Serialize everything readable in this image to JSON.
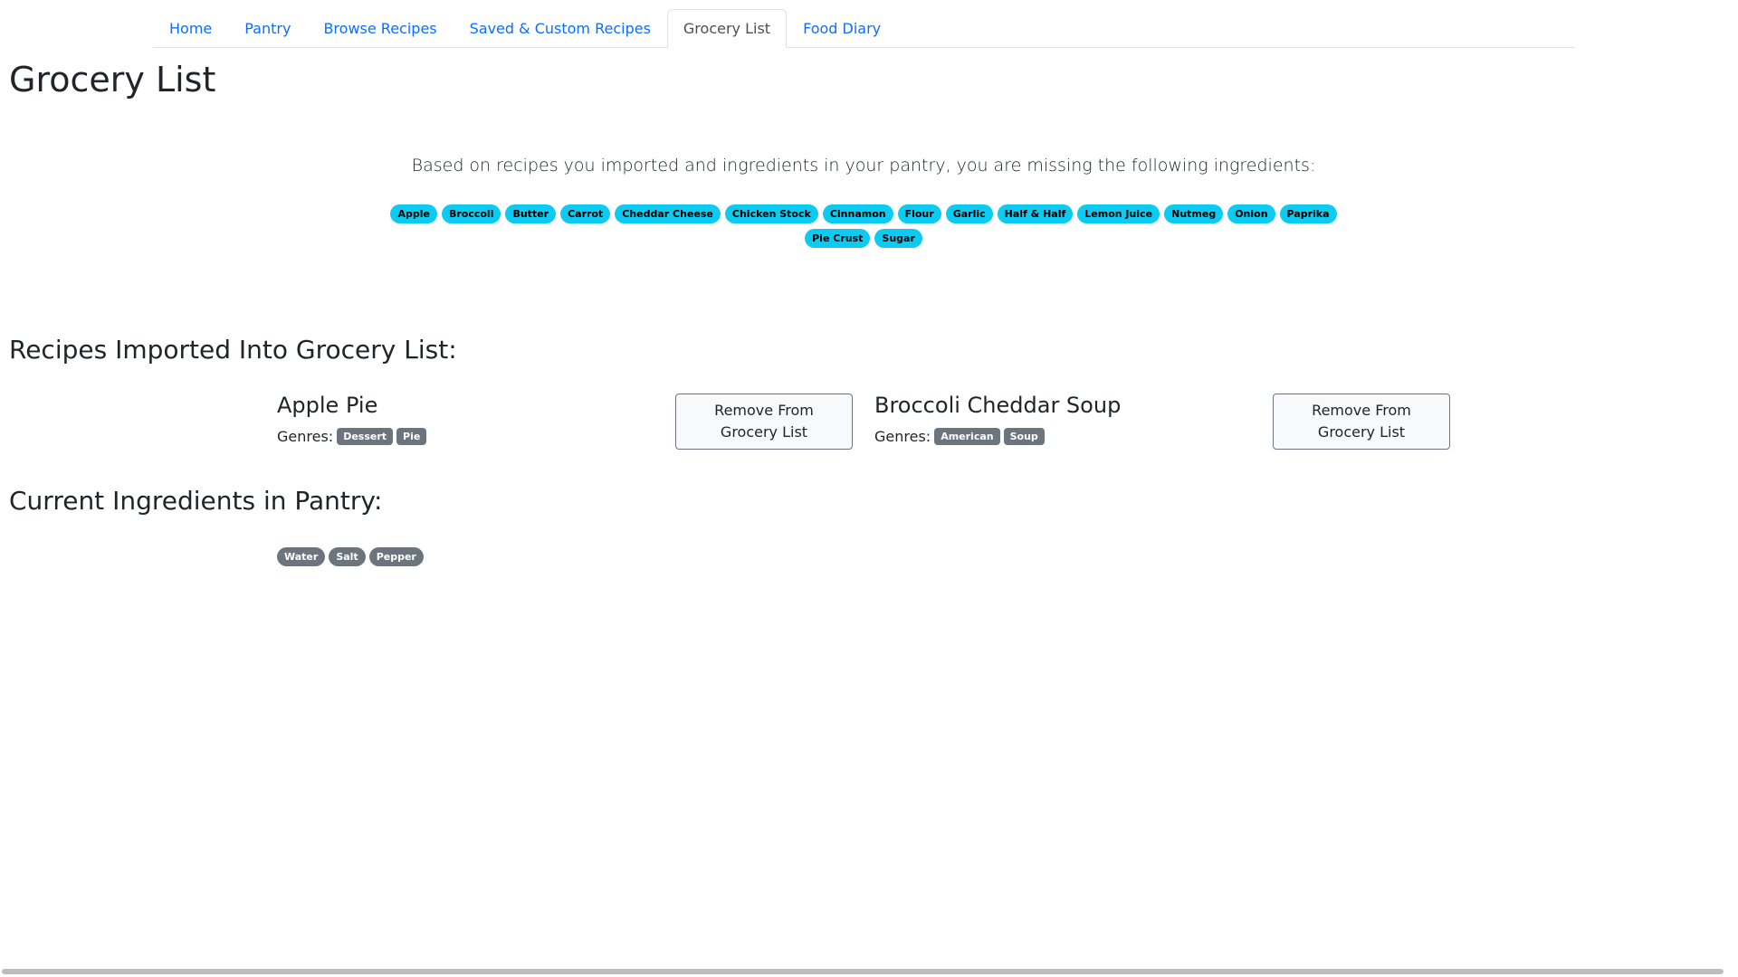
{
  "tabs": [
    {
      "label": "Home",
      "active": false
    },
    {
      "label": "Pantry",
      "active": false
    },
    {
      "label": "Browse Recipes",
      "active": false
    },
    {
      "label": "Saved & Custom Recipes",
      "active": false
    },
    {
      "label": "Grocery List",
      "active": true
    },
    {
      "label": "Food Diary",
      "active": false
    }
  ],
  "page_title": "Grocery List",
  "missing": {
    "intro": "Based on recipes you imported and ingredients in your pantry, you are missing the following ingredients:",
    "ingredients": [
      "Apple",
      "Broccoli",
      "Butter",
      "Carrot",
      "Cheddar Cheese",
      "Chicken Stock",
      "Cinnamon",
      "Flour",
      "Garlic",
      "Half & Half",
      "Lemon Juice",
      "Nutmeg",
      "Onion",
      "Paprika",
      "Pie Crust",
      "Sugar"
    ]
  },
  "imported": {
    "heading": "Recipes Imported Into Grocery List:",
    "genres_label": "Genres:",
    "remove_label": "Remove From Grocery List",
    "recipes": [
      {
        "name": "Apple Pie",
        "genres": [
          "Dessert",
          "Pie"
        ]
      },
      {
        "name": "Broccoli Cheddar Soup",
        "genres": [
          "American",
          "Soup"
        ]
      }
    ]
  },
  "pantry": {
    "heading": "Current Ingredients in Pantry:",
    "ingredients": [
      "Water",
      "Salt",
      "Pepper"
    ]
  },
  "colors": {
    "link": "#0d6efd",
    "info_badge": "#0dcaf0",
    "secondary_badge": "#6c757d"
  }
}
